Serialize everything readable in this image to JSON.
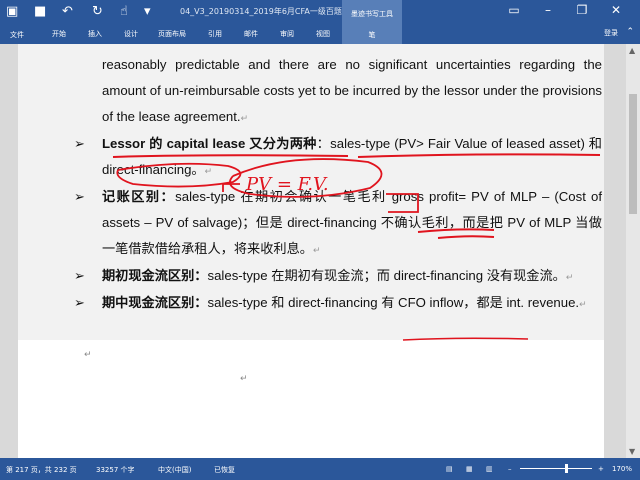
{
  "titlebar": {
    "document_title": "04_V3_20190314_2019年6月CFA一级百题预...",
    "contextual_tools": "墨迹书写工具",
    "contextual_tab": "笔",
    "login": "登录"
  },
  "ribbon": {
    "file": "文件",
    "tabs": [
      "开始",
      "插入",
      "设计",
      "页面布局",
      "引用",
      "邮件",
      "审阅",
      "视图"
    ]
  },
  "document": {
    "paragraph1": "reasonably predictable and there are no significant uncertainties regarding the amount of un-reimbursable costs yet to be incurred by the lessor under the provisions of the lease agreement.",
    "bullet1_bold": "Lessor 的 capital lease 又分为两种",
    "bullet1_rest": "：sales-type (PV> Fair Value of leased asset) 和 direct-financing。",
    "bullet2_bold": "记账区别：",
    "bullet2_rest": "sales-type 在期初会确认一笔毛利 gross profit= PV of MLP – (Cost of assets – PV of salvage)；但是 direct-financing 不确认毛利，而是把 PV of MLP 当做一笔借款借给承租人，将来收利息。",
    "bullet3_bold": "期初现金流区别：",
    "bullet3_rest": "sales-type 在期初有现金流；而 direct-financing 没有现金流。",
    "bullet4_bold": "期中现金流区别：",
    "bullet4_rest": "sales-type 和 direct-financing 有 CFO inflow，都是 int. revenue.",
    "handwriting": "PV = F.V."
  },
  "statusbar": {
    "page": "第 217 页，共 232 页",
    "words": "33257 个字",
    "language": "中文(中国)",
    "recovered": "已恢复",
    "zoom": "170%"
  },
  "colors": {
    "brand": "#2b579a",
    "ink": "#e0141e"
  }
}
